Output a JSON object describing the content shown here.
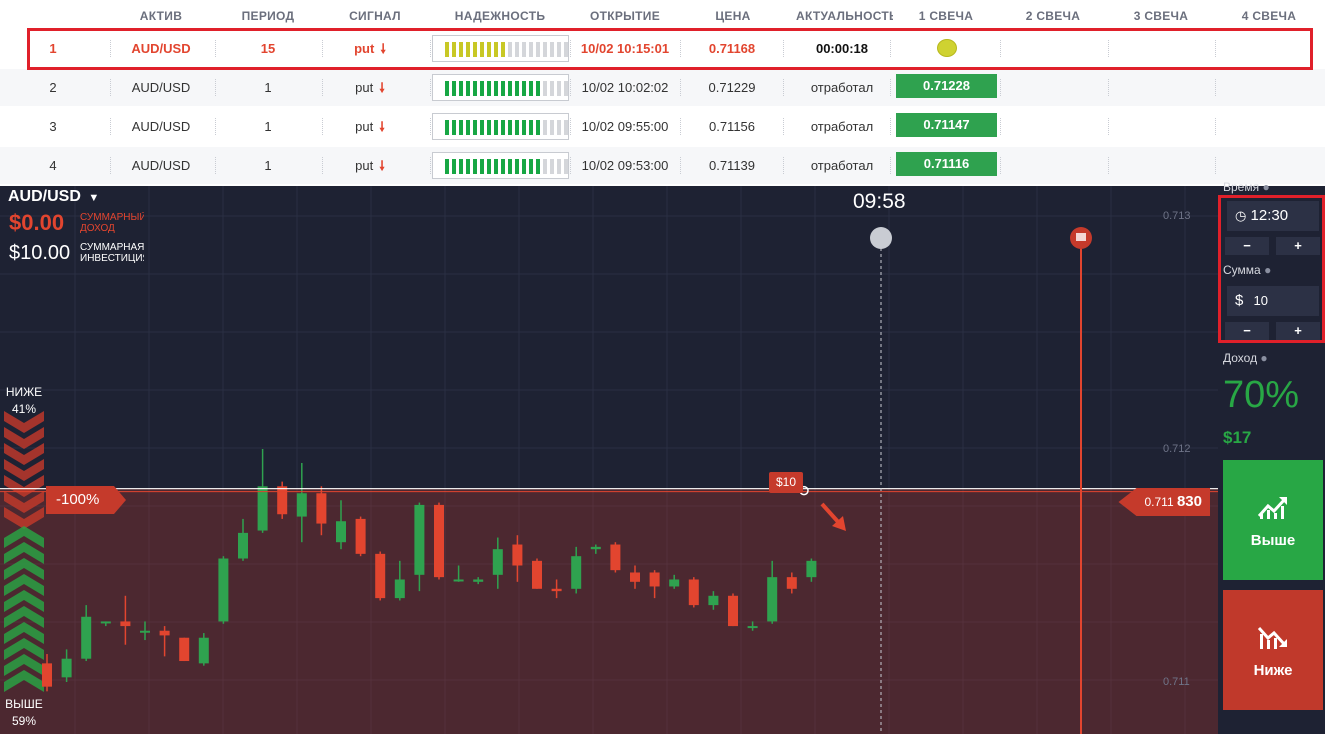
{
  "table": {
    "headers": [
      "АКТИВ",
      "ПЕРИОД",
      "СИГНАЛ",
      "НАДЕЖНОСТЬ",
      "ОТКРЫТИЕ",
      "ЦЕНА",
      "АКТУАЛЬНОСТЬ",
      "1 СВЕЧА",
      "2 СВЕЧА",
      "3 СВЕЧА",
      "4 СВЕЧА"
    ],
    "rows": [
      {
        "num": "1",
        "asset": "AUD/USD",
        "period": "15",
        "signal": "put",
        "reliability": 0.5,
        "reliability_color": "#c8c825",
        "opened": "10/02 10:15:01",
        "price": "0.71168",
        "actual": "00:00:18",
        "candle1": ""
      },
      {
        "num": "2",
        "asset": "AUD/USD",
        "period": "1",
        "signal": "put",
        "reliability": 0.75,
        "reliability_color": "#17a744",
        "opened": "10/02 10:02:02",
        "price": "0.71229",
        "actual": "отработал",
        "candle1": "0.71228"
      },
      {
        "num": "3",
        "asset": "AUD/USD",
        "period": "1",
        "signal": "put",
        "reliability": 0.75,
        "reliability_color": "#17a744",
        "opened": "10/02 09:55:00",
        "price": "0.71156",
        "actual": "отработал",
        "candle1": "0.71147"
      },
      {
        "num": "4",
        "asset": "AUD/USD",
        "period": "1",
        "signal": "put",
        "reliability": 0.75,
        "reliability_color": "#17a744",
        "opened": "10/02 09:53:00",
        "price": "0.71139",
        "actual": "отработал",
        "candle1": "0.71116"
      }
    ]
  },
  "chart": {
    "asset": "AUD/USD",
    "income_value": "$0.00",
    "income_label": "СУММАРНЫЙ ДОХОД",
    "invest_value": "$10.00",
    "invest_label": "СУММАРНАЯ ИНВЕСТИЦИЯ",
    "timer": "09:58",
    "lower_label": "НИЖЕ",
    "lower_pct": "41%",
    "higher_label": "ВЫШЕ",
    "higher_pct": "59%",
    "pct_tag": "-100%",
    "price_tag_prefix": "0.711",
    "price_tag_bold": "830",
    "deal_tag": "$10",
    "axis": [
      "0.713",
      "0.712",
      "0.711"
    ]
  },
  "chart_data": {
    "type": "candlestick",
    "ylabels": [
      "0.713",
      "0.712",
      "0.711"
    ],
    "candles": [
      {
        "dir": "down",
        "o": 0.71108,
        "c": 0.71098,
        "h": 0.71112,
        "l": 0.71096
      },
      {
        "dir": "up",
        "o": 0.71102,
        "c": 0.7111,
        "h": 0.71114,
        "l": 0.711
      },
      {
        "dir": "up",
        "o": 0.7111,
        "c": 0.71128,
        "h": 0.71133,
        "l": 0.71109
      },
      {
        "dir": "flat",
        "o": 0.71126,
        "c": 0.71126,
        "h": 0.71126,
        "l": 0.71124
      },
      {
        "dir": "down",
        "o": 0.71126,
        "c": 0.71124,
        "h": 0.71137,
        "l": 0.71116
      },
      {
        "dir": "flat",
        "o": 0.71122,
        "c": 0.71122,
        "h": 0.71126,
        "l": 0.71118
      },
      {
        "dir": "down",
        "o": 0.71122,
        "c": 0.7112,
        "h": 0.71124,
        "l": 0.71111
      },
      {
        "dir": "down",
        "o": 0.71119,
        "c": 0.71109,
        "h": 0.71119,
        "l": 0.71109
      },
      {
        "dir": "up",
        "o": 0.71108,
        "c": 0.71119,
        "h": 0.71121,
        "l": 0.71107
      },
      {
        "dir": "up",
        "o": 0.71126,
        "c": 0.71153,
        "h": 0.71154,
        "l": 0.71125
      },
      {
        "dir": "up",
        "o": 0.71153,
        "c": 0.71164,
        "h": 0.7117,
        "l": 0.71152
      },
      {
        "dir": "up",
        "o": 0.71165,
        "c": 0.71184,
        "h": 0.712,
        "l": 0.71164
      },
      {
        "dir": "down",
        "o": 0.71184,
        "c": 0.71172,
        "h": 0.71186,
        "l": 0.7117
      },
      {
        "dir": "up",
        "o": 0.71171,
        "c": 0.71181,
        "h": 0.71194,
        "l": 0.7116
      },
      {
        "dir": "down",
        "o": 0.71181,
        "c": 0.71168,
        "h": 0.71184,
        "l": 0.71163
      },
      {
        "dir": "up",
        "o": 0.7116,
        "c": 0.71169,
        "h": 0.71178,
        "l": 0.71157
      },
      {
        "dir": "down",
        "o": 0.7117,
        "c": 0.71155,
        "h": 0.71171,
        "l": 0.71154
      },
      {
        "dir": "down",
        "o": 0.71155,
        "c": 0.71136,
        "h": 0.71156,
        "l": 0.71135
      },
      {
        "dir": "up",
        "o": 0.71136,
        "c": 0.71144,
        "h": 0.71152,
        "l": 0.71135
      },
      {
        "dir": "up",
        "o": 0.71146,
        "c": 0.71176,
        "h": 0.71177,
        "l": 0.71139
      },
      {
        "dir": "down",
        "o": 0.71176,
        "c": 0.71145,
        "h": 0.71177,
        "l": 0.71144
      },
      {
        "dir": "flat",
        "o": 0.71144,
        "c": 0.71144,
        "h": 0.7115,
        "l": 0.71143
      },
      {
        "dir": "flat",
        "o": 0.71143,
        "c": 0.71144,
        "h": 0.71145,
        "l": 0.71142
      },
      {
        "dir": "up",
        "o": 0.71146,
        "c": 0.71157,
        "h": 0.71162,
        "l": 0.7114
      },
      {
        "dir": "down",
        "o": 0.71159,
        "c": 0.7115,
        "h": 0.71163,
        "l": 0.71143
      },
      {
        "dir": "down",
        "o": 0.71152,
        "c": 0.7114,
        "h": 0.71153,
        "l": 0.7114
      },
      {
        "dir": "down",
        "o": 0.71139,
        "c": 0.7114,
        "h": 0.71144,
        "l": 0.71136
      },
      {
        "dir": "up",
        "o": 0.7114,
        "c": 0.71154,
        "h": 0.71158,
        "l": 0.71138
      },
      {
        "dir": "flat",
        "o": 0.71157,
        "c": 0.71158,
        "h": 0.71159,
        "l": 0.71155
      },
      {
        "dir": "down",
        "o": 0.71159,
        "c": 0.71148,
        "h": 0.7116,
        "l": 0.71147
      },
      {
        "dir": "down",
        "o": 0.71147,
        "c": 0.71143,
        "h": 0.7115,
        "l": 0.7114
      },
      {
        "dir": "down",
        "o": 0.71147,
        "c": 0.71141,
        "h": 0.71148,
        "l": 0.71136
      },
      {
        "dir": "up",
        "o": 0.71141,
        "c": 0.71144,
        "h": 0.71146,
        "l": 0.7114
      },
      {
        "dir": "down",
        "o": 0.71144,
        "c": 0.71133,
        "h": 0.71145,
        "l": 0.71132
      },
      {
        "dir": "up",
        "o": 0.71133,
        "c": 0.71137,
        "h": 0.71139,
        "l": 0.71131
      },
      {
        "dir": "down",
        "o": 0.71137,
        "c": 0.71124,
        "h": 0.71138,
        "l": 0.71124
      },
      {
        "dir": "flat",
        "o": 0.71124,
        "c": 0.71124,
        "h": 0.71126,
        "l": 0.71122
      },
      {
        "dir": "up",
        "o": 0.71126,
        "c": 0.71145,
        "h": 0.71152,
        "l": 0.71125
      },
      {
        "dir": "down",
        "o": 0.71145,
        "c": 0.7114,
        "h": 0.71147,
        "l": 0.71138
      },
      {
        "dir": "up",
        "o": 0.71145,
        "c": 0.71152,
        "h": 0.71153,
        "l": 0.71143
      }
    ]
  },
  "panel": {
    "time_label": "Время",
    "time_value": "12:30",
    "amount_label": "Сумма",
    "amount_currency": "$",
    "amount_value": "10",
    "minus": "−",
    "plus": "+",
    "income_label": "Доход",
    "income_pct": "70%",
    "income_value": "$17",
    "up_label": "Выше",
    "down_label": "Ниже",
    "up_color": "#28a745",
    "down_color": "#c0392b"
  }
}
